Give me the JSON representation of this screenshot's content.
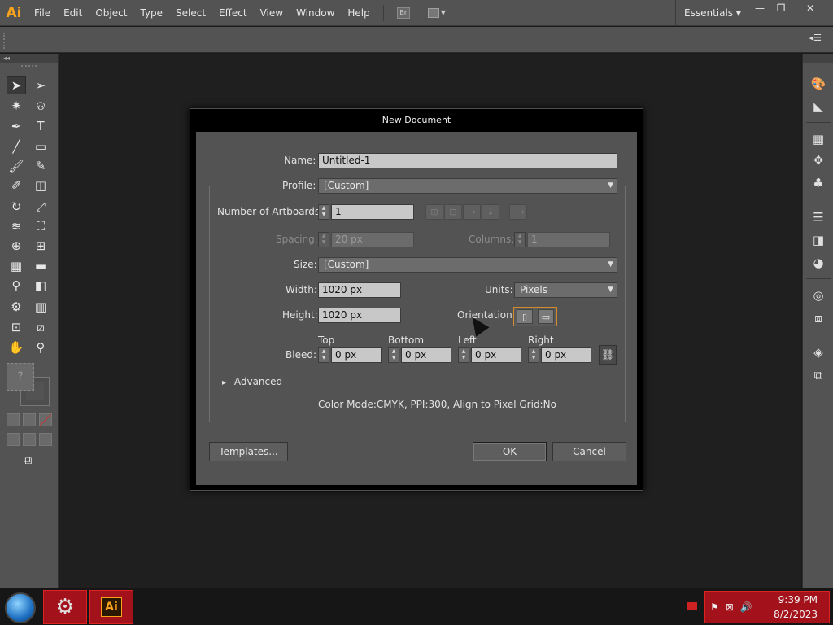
{
  "app": {
    "logo": "Ai",
    "menu": [
      "File",
      "Edit",
      "Object",
      "Type",
      "Select",
      "Effect",
      "View",
      "Window",
      "Help"
    ],
    "bridge_label": "Br",
    "workspace": "Essentials",
    "workspace_arrow": "▾",
    "window_controls": [
      "—",
      "❐",
      "✕"
    ]
  },
  "dialog": {
    "title": "New Document",
    "name": {
      "label": "Name:",
      "value": "Untitled-1"
    },
    "profile": {
      "label": "Profile:",
      "value": "[Custom]"
    },
    "artboards": {
      "label": "Number of Artboards:",
      "value": "1"
    },
    "spacing": {
      "label": "Spacing:",
      "value": "20 px"
    },
    "columns": {
      "label": "Columns:",
      "value": "1"
    },
    "size": {
      "label": "Size:",
      "value": "[Custom]"
    },
    "width": {
      "label": "Width:",
      "value": "1020 px"
    },
    "units": {
      "label": "Units:",
      "value": "Pixels"
    },
    "height": {
      "label": "Height:",
      "value": "1020 px"
    },
    "orientation": {
      "label": "Orientation:"
    },
    "bleed": {
      "label": "Bleed:",
      "top": {
        "label": "Top",
        "value": "0 px"
      },
      "bottom": {
        "label": "Bottom",
        "value": "0 px"
      },
      "left": {
        "label": "Left",
        "value": "0 px"
      },
      "right": {
        "label": "Right",
        "value": "0 px"
      }
    },
    "advanced_label": "Advanced",
    "advanced_arrow": "▸",
    "summary": "Color Mode:CMYK, PPI:300, Align to Pixel Grid:No",
    "templates_button": "Templates...",
    "ok_button": "OK",
    "cancel_button": "Cancel"
  },
  "taskbar": {
    "time": "9:39 PM",
    "date": "8/2/2023",
    "ai_label": "Ai"
  },
  "colors": {
    "accent_orange": "#f9a21b",
    "taskbar_red": "#a3121a",
    "panel_gray": "#535353"
  },
  "tools": [
    "selection-tool",
    "direct-selection-tool",
    "magic-wand-tool",
    "lasso-tool",
    "pen-tool",
    "type-tool",
    "line-tool",
    "rectangle-tool",
    "paintbrush-tool",
    "pencil-tool",
    "blob-brush-tool",
    "eraser-tool",
    "rotate-tool",
    "scale-tool",
    "width-tool",
    "free-transform-tool",
    "shape-builder-tool",
    "perspective-grid-tool",
    "mesh-tool",
    "gradient-tool",
    "eyedropper-tool",
    "blend-tool",
    "symbol-sprayer-tool",
    "column-graph-tool",
    "artboard-tool",
    "slice-tool",
    "hand-tool",
    "zoom-tool"
  ]
}
